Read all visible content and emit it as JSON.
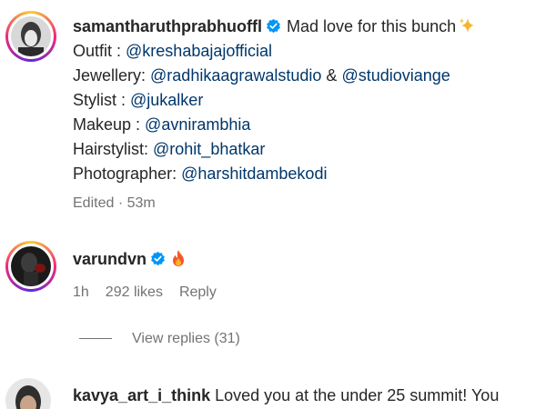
{
  "caption": {
    "username": "samantharuthprabhuoffl",
    "text": "Mad love for this bunch",
    "emoji": "sparkles-icon",
    "credits": [
      {
        "label": "Outfit : ",
        "mentions": [
          "@kreshabajajofficial"
        ]
      },
      {
        "label": "Jewellery: ",
        "mentions": [
          "@radhikaagrawalstudio",
          "@studioviange"
        ],
        "joiner": " & "
      },
      {
        "label": "Stylist : ",
        "mentions": [
          "@jukalker"
        ]
      },
      {
        "label": "Makeup : ",
        "mentions": [
          "@avnirambhia"
        ]
      },
      {
        "label": "Hairstylist: ",
        "mentions": [
          "@rohit_bhatkar"
        ]
      },
      {
        "label": "Photographer: ",
        "mentions": [
          "@harshitdambekodi"
        ]
      }
    ],
    "meta": "Edited · 53m"
  },
  "comment1": {
    "username": "varundvn",
    "emoji": "fire-icon",
    "time": "1h",
    "likes": "292 likes",
    "reply_label": "Reply",
    "view_replies": "View replies (31)"
  },
  "comment2": {
    "username": "kavya_art_i_think",
    "text": "Loved you at the under 25 summit! You"
  },
  "colors": {
    "mention": "#00376b",
    "verified": "#0095f6",
    "muted": "#737373",
    "text": "#262626"
  }
}
